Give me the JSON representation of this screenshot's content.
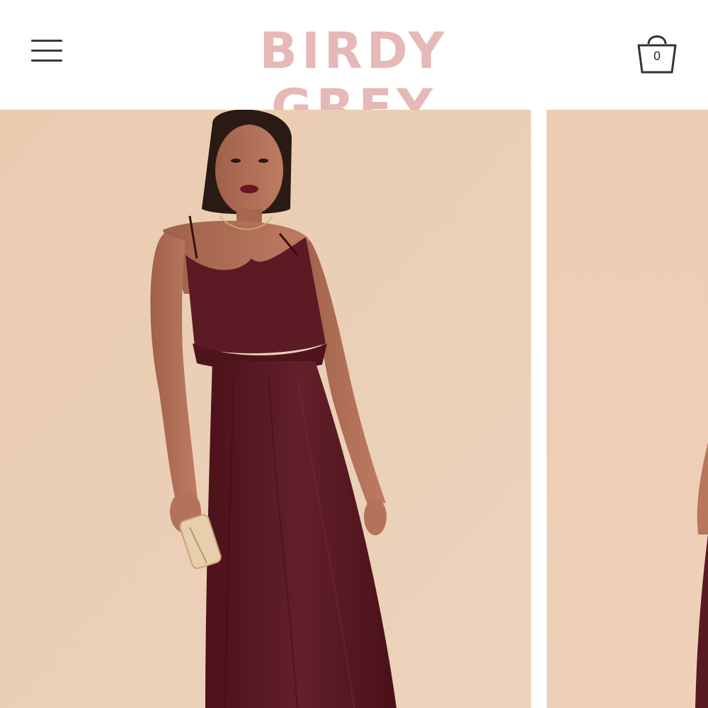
{
  "header": {
    "brand": "BIRDY GREY",
    "cart_count": "0"
  },
  "icons": {
    "menu": "hamburger-menu-icon",
    "cart": "shopping-bag-icon"
  },
  "colors": {
    "brand_pink": "#e6b8b6",
    "backdrop_beige": "#ebcdb1",
    "dress_burgundy": "#5a1a22",
    "page_bg": "#ffffff"
  },
  "gallery": {
    "slides": [
      "product-photo",
      "product-photo"
    ]
  }
}
